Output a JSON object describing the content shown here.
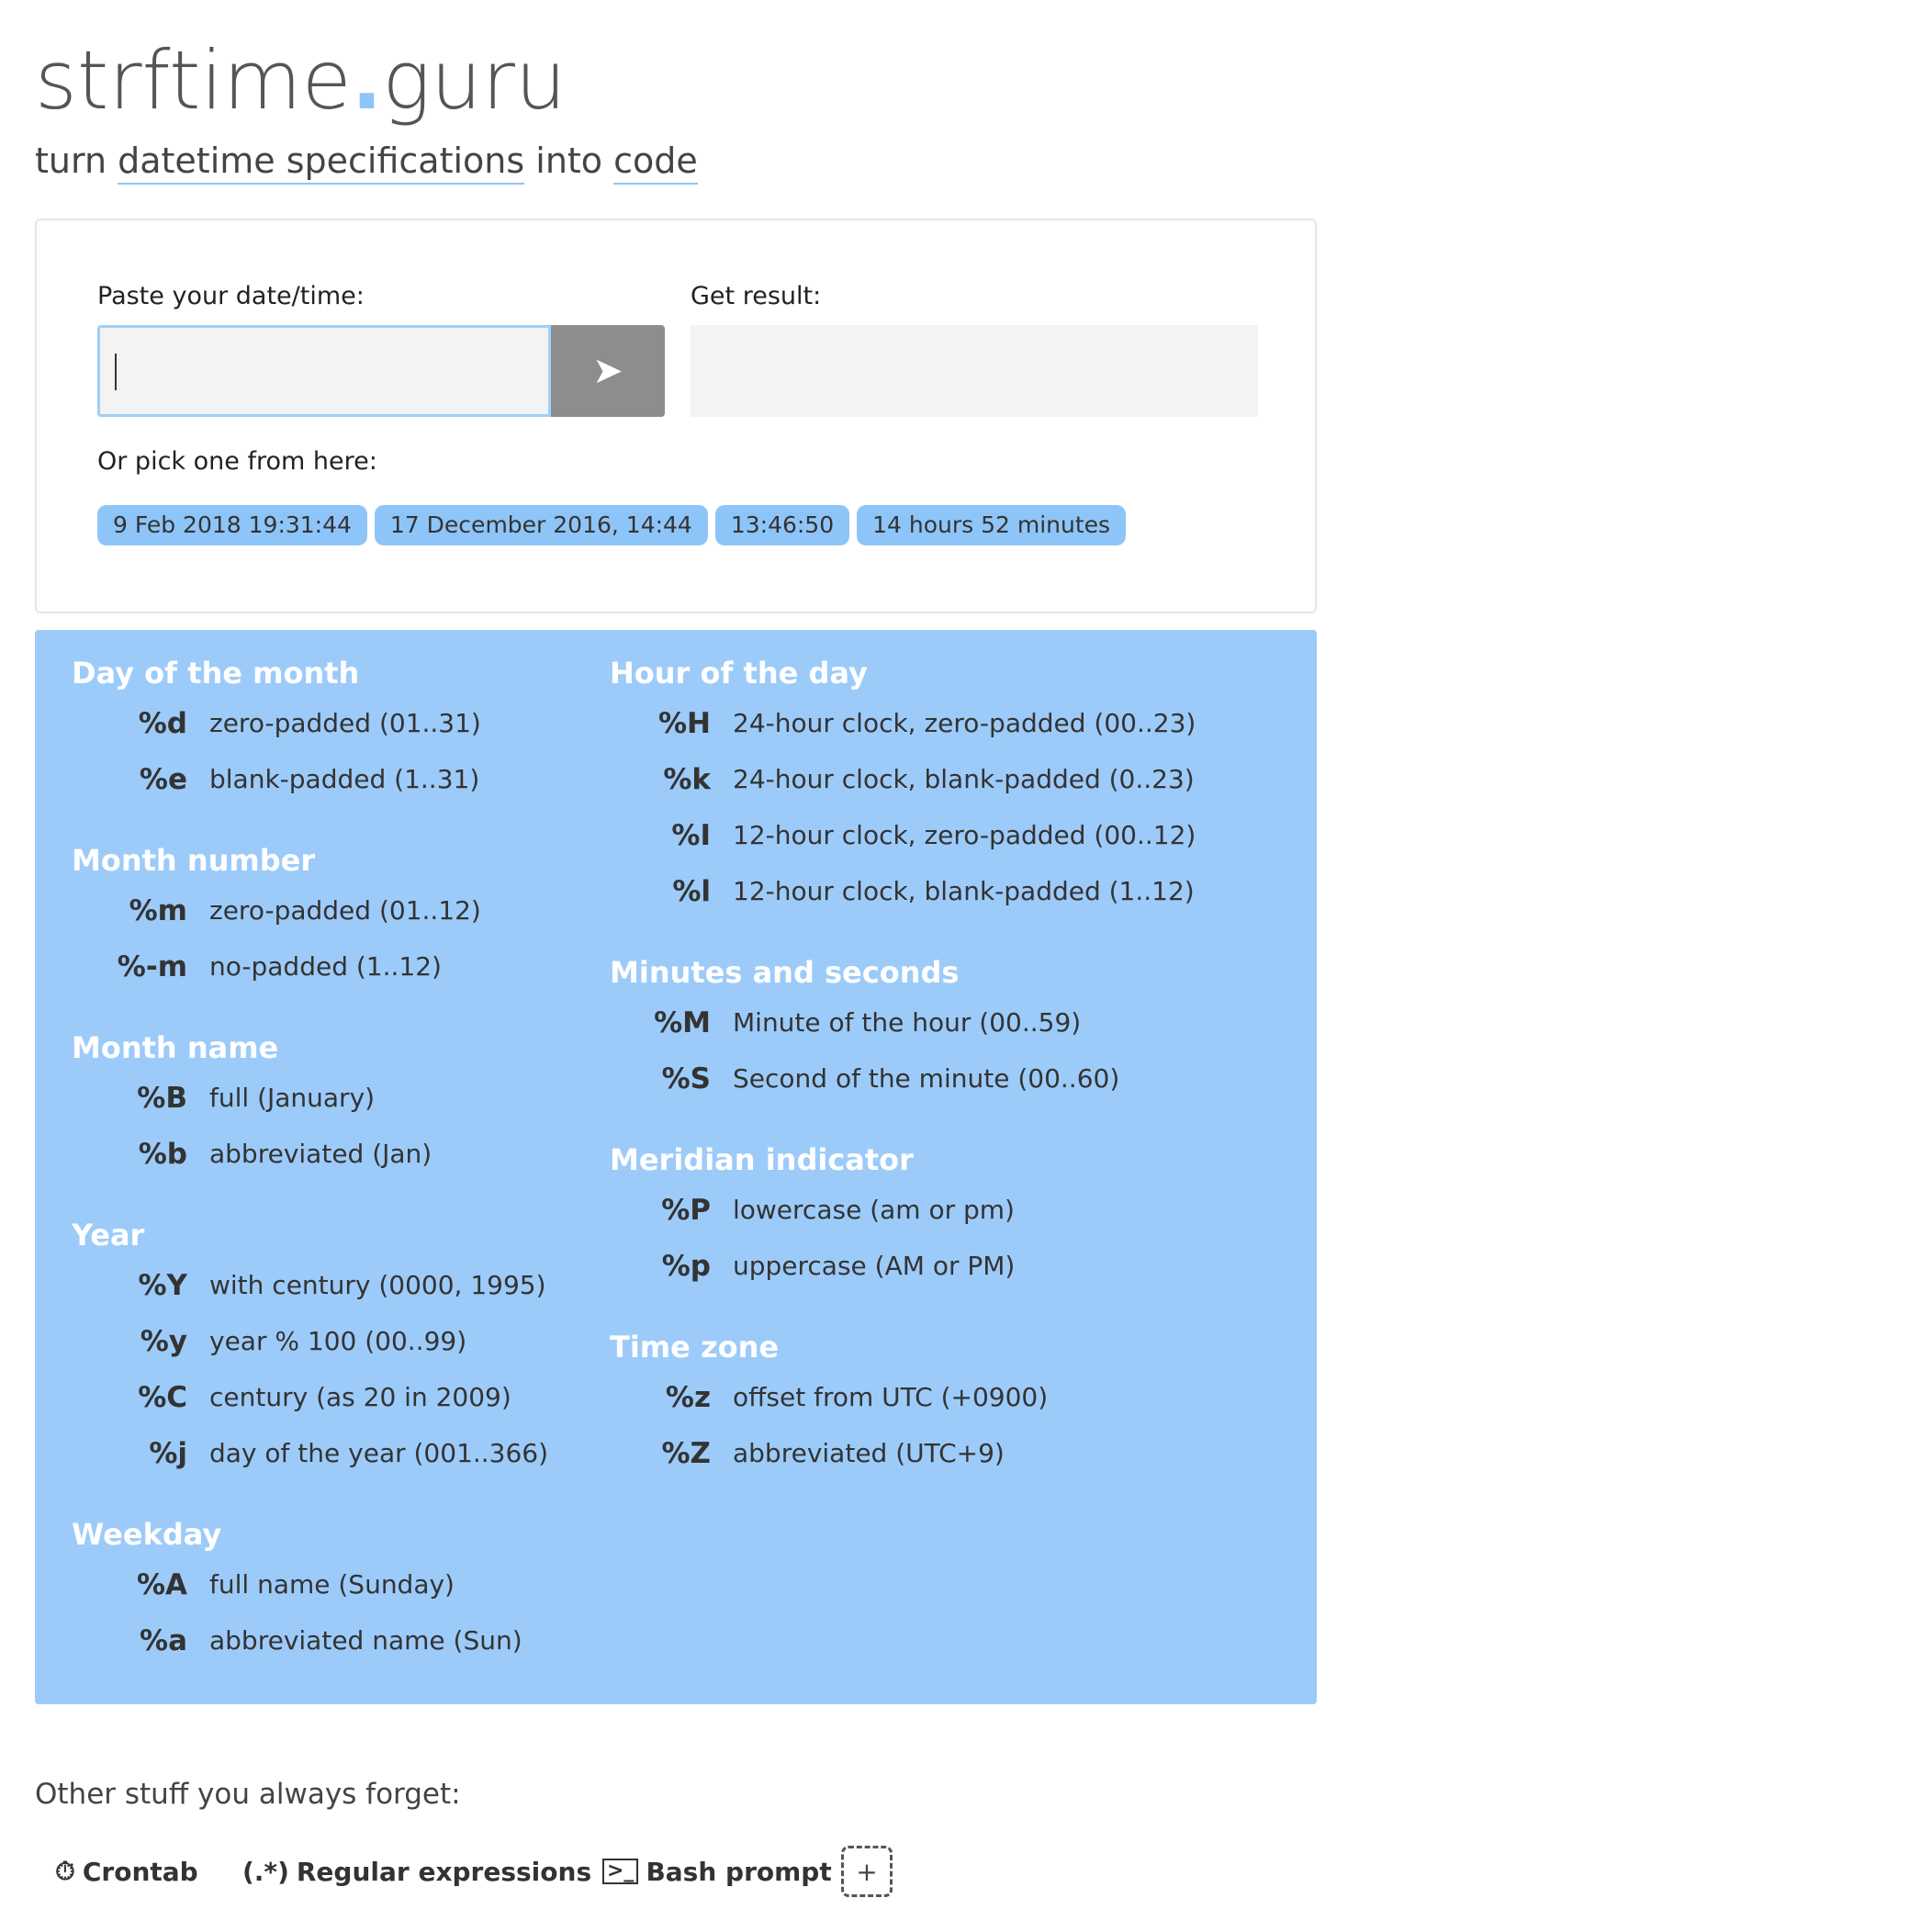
{
  "header": {
    "logo_part1": "strftime",
    "logo_dot": ".",
    "logo_part2": "guru",
    "tagline_prefix": "turn ",
    "tagline_link1": "datetime specifications",
    "tagline_mid": " into ",
    "tagline_link2": "code"
  },
  "input_card": {
    "paste_label": "Paste your date/time:",
    "paste_value": "",
    "submit_icon": "➤",
    "result_label": "Get result:",
    "result_value": "",
    "pick_label": "Or pick one from here:",
    "examples": [
      "9 Feb 2018 19:31:44",
      "17 December 2016, 14:44",
      "13:46:50",
      "14 hours 52 minutes"
    ]
  },
  "reference": {
    "left": [
      {
        "heading": "Day of the month",
        "items": [
          {
            "code": "%d",
            "desc": "zero-padded (01..31)"
          },
          {
            "code": "%e",
            "desc": "blank-padded (1..31)"
          }
        ]
      },
      {
        "heading": "Month number",
        "items": [
          {
            "code": "%m",
            "desc": "zero-padded (01..12)"
          },
          {
            "code": "%-m",
            "desc": "no-padded (1..12)"
          }
        ]
      },
      {
        "heading": "Month name",
        "items": [
          {
            "code": "%B",
            "desc": "full (January)"
          },
          {
            "code": "%b",
            "desc": "abbreviated (Jan)"
          }
        ]
      },
      {
        "heading": "Year",
        "items": [
          {
            "code": "%Y",
            "desc": "with century (0000, 1995)"
          },
          {
            "code": "%y",
            "desc": "year % 100 (00..99)"
          },
          {
            "code": "%C",
            "desc": "century (as 20 in 2009)"
          },
          {
            "code": "%j",
            "desc": "day of the year (001..366)"
          }
        ]
      },
      {
        "heading": "Weekday",
        "items": [
          {
            "code": "%A",
            "desc": "full name (Sunday)"
          },
          {
            "code": "%a",
            "desc": "abbreviated name (Sun)"
          }
        ]
      }
    ],
    "right": [
      {
        "heading": "Hour of the day",
        "items": [
          {
            "code": "%H",
            "desc": "24-hour clock, zero-padded (00..23)"
          },
          {
            "code": "%k",
            "desc": "24-hour clock, blank-padded (0..23)"
          },
          {
            "code": "%I",
            "desc": "12-hour clock, zero-padded (00..12)"
          },
          {
            "code": "%l",
            "desc": "12-hour clock, blank-padded (1..12)"
          }
        ]
      },
      {
        "heading": "Minutes and seconds",
        "items": [
          {
            "code": "%M",
            "desc": "Minute of the hour (00..59)"
          },
          {
            "code": "%S",
            "desc": "Second of the minute (00..60)"
          }
        ]
      },
      {
        "heading": "Meridian indicator",
        "items": [
          {
            "code": "%P",
            "desc": "lowercase (am or pm)"
          },
          {
            "code": "%p",
            "desc": "uppercase (AM or PM)"
          }
        ]
      },
      {
        "heading": "Time zone",
        "items": [
          {
            "code": "%z",
            "desc": "offset from UTC (+0900)"
          },
          {
            "code": "%Z",
            "desc": "abbreviated (UTC+9)"
          }
        ]
      }
    ]
  },
  "footer": {
    "other_label": "Other stuff you always forget:",
    "links": [
      {
        "icon": "stopwatch-icon",
        "glyph": "⏱",
        "label": "Crontab"
      },
      {
        "icon": "regex-icon",
        "glyph": "(.*)",
        "label": "Regular expressions"
      },
      {
        "icon": "terminal-icon",
        "glyph": ">_",
        "label": "Bash prompt"
      }
    ],
    "add_icon": "+"
  },
  "colors": {
    "accent": "#8ec5f8",
    "panel": "#9ccbfa",
    "button": "#8d8d8d"
  }
}
